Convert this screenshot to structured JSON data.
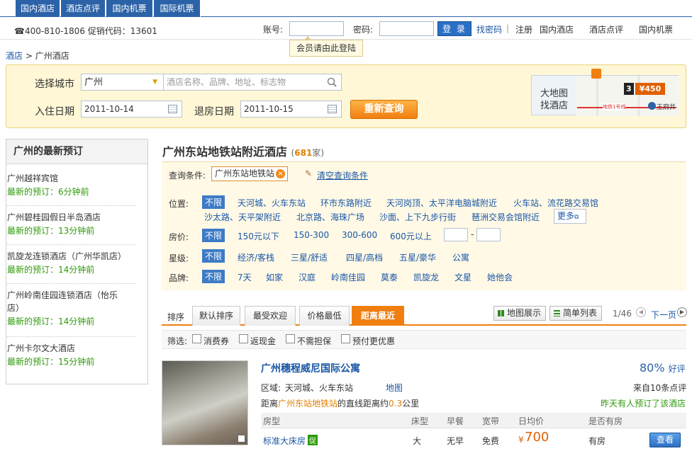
{
  "top_tabs": [
    "国内酒店",
    "酒店点评",
    "国内机票",
    "国际机票"
  ],
  "login_bar": {
    "phone": "☎400-810-1806 促销代码：13601",
    "account_label": "账号:",
    "password_label": "密码:",
    "login_button": "登 录",
    "forgot": "找密码",
    "sep": "|",
    "register": "注册",
    "links": [
      "国内酒店",
      "酒店点评",
      "国内机票"
    ],
    "tooltip": "会员请由此登陆"
  },
  "breadcrumb": {
    "root": "酒店",
    "sep": ">",
    "current": "广州酒店"
  },
  "search": {
    "city_label": "选择城市",
    "city_value": "广州",
    "keyword_placeholder": "酒店名称、品牌、地址、标志物",
    "checkin_label": "入住日期",
    "checkin_value": "2011-10-14",
    "checkout_label": "退房日期",
    "checkout_value": "2011-10-15",
    "query_button": "重新查询",
    "map_label_1": "大地图",
    "map_label_2": "找酒店",
    "map_count": "3",
    "map_price": "¥450",
    "map_station": "王府井",
    "map_line": "地铁1号线"
  },
  "sidebar": {
    "title": "广州的最新预订",
    "items": [
      {
        "name": "广州越祥宾馆",
        "time": "最新的预订：6分钟前"
      },
      {
        "name": "广州碧桂园假日半岛酒店",
        "time": "最新的预订：13分钟前"
      },
      {
        "name": "凯旋龙连锁酒店（广州华凯店）",
        "time": "最新的预订：14分钟前"
      },
      {
        "name": "广州岭南佳园连锁酒店（怡乐店）",
        "time": "最新的预订：14分钟前"
      },
      {
        "name": "广州卡尔文大酒店",
        "time": "最新的预订：15分钟前"
      }
    ]
  },
  "main": {
    "title": "广州东站地铁站附近酒店",
    "count_open": "(",
    "count": "681",
    "count_unit": "家)",
    "cond_label": "查询条件:",
    "cond_value": "广州东站地铁站",
    "clear": "清空查询条件",
    "filters": {
      "location_label": "位置:",
      "location_row1": [
        "不限",
        "天河城、火车东站",
        "环市东路附近",
        "天河岗顶、太平洋电脑城附近",
        "火车站、流花路交易馆"
      ],
      "location_row2": [
        "沙太路、天平架附近",
        "北京路、海珠广场",
        "沙面、上下九步行街",
        "琶洲交易会馆附近"
      ],
      "more": "更多",
      "price_label": "房价:",
      "prices": [
        "不限",
        "150元以下",
        "150-300",
        "300-600",
        "600元以上"
      ],
      "price_dash": "-",
      "star_label": "星级:",
      "stars": [
        "不限",
        "经济/客栈",
        "三星/舒适",
        "四星/高档",
        "五星/豪华",
        "公寓"
      ],
      "brand_label": "品牌:",
      "brands": [
        "不限",
        "7天",
        "如家",
        "汉庭",
        "岭南佳园",
        "莫泰",
        "凯旋龙",
        "文星",
        "她他会"
      ]
    },
    "sort": {
      "label": "排序",
      "tabs": [
        "默认排序",
        "最受欢迎",
        "价格最低",
        "距离最近"
      ],
      "map_view": "地图展示",
      "list_view": "简单列表",
      "page": "1/46",
      "next": "下一页"
    },
    "screen": {
      "label": "筛选:",
      "options": [
        "消费券",
        "返现金",
        "不需担保",
        "预付更优惠"
      ]
    },
    "hotel": {
      "name": "广州穗程威尼国际公寓",
      "score": "80%",
      "score_label": "好评",
      "reviews": "来自10条点评",
      "area_label": "区域:",
      "area": "天河城、火车东站",
      "map_link": "地图",
      "dist_pre": "距离",
      "dist_place": "广州东站地铁站",
      "dist_mid": "的直线距离约",
      "dist_val": "0.3",
      "dist_unit": "公里",
      "booked": "昨天有人预订了该酒店",
      "table_headers": [
        "房型",
        "床型",
        "早餐",
        "宽带",
        "日均价",
        "是否有房"
      ],
      "room": {
        "type": "标准大床房",
        "badge": "促",
        "bed": "大",
        "breakfast": "无早",
        "broadband": "免费",
        "currency": "¥",
        "price": "700",
        "avail": "有房",
        "button": "查看"
      }
    }
  }
}
